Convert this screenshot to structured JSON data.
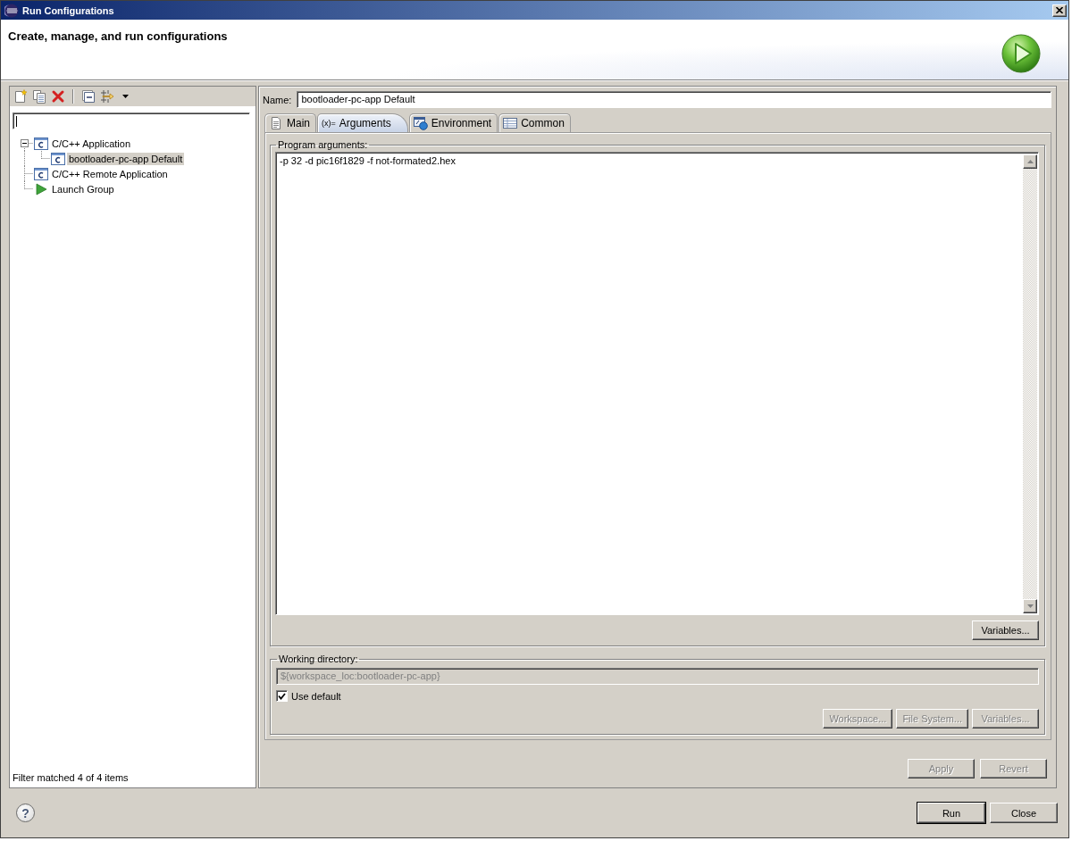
{
  "window": {
    "title": "Run Configurations"
  },
  "header": {
    "title": "Create, manage, and run configurations"
  },
  "filter": {
    "focused": true
  },
  "tree": [
    {
      "label": "C/C++ Application",
      "kind": "c-app",
      "selected": false,
      "expanded": true,
      "children": [
        {
          "label": "bootloader-pc-app Default",
          "kind": "c-app",
          "selected": true
        }
      ]
    },
    {
      "label": "C/C++ Remote Application",
      "kind": "c-app",
      "selected": false
    },
    {
      "label": "Launch Group",
      "kind": "group",
      "selected": false
    }
  ],
  "filter_status": "Filter matched 4 of 4 items",
  "name": {
    "label": "Name:",
    "value": "bootloader-pc-app Default"
  },
  "tabs": [
    {
      "label": "Main",
      "selected": false
    },
    {
      "label": "Arguments",
      "glyph": "(x)=",
      "selected": true
    },
    {
      "label": "Environment",
      "selected": false
    },
    {
      "label": "Common",
      "selected": false
    }
  ],
  "program_arguments": {
    "label": "Program arguments:",
    "value": "-p 32 -d pic16f1829 -f not-formated2.hex",
    "button": {
      "label": "Variables...",
      "disabled": false
    }
  },
  "working_directory": {
    "label": "Working directory:",
    "value": "${workspace_loc:bootloader-pc-app}",
    "disabled": true,
    "use_default": {
      "label": "Use default",
      "checked": true
    },
    "buttons": [
      {
        "label": "Workspace...",
        "disabled": true
      },
      {
        "label": "File System...",
        "disabled": true
      },
      {
        "label": "Variables...",
        "disabled": true
      }
    ]
  },
  "config_buttons": [
    {
      "label": "Apply",
      "disabled": true
    },
    {
      "label": "Revert",
      "disabled": true
    }
  ],
  "help": {
    "glyph": "?"
  },
  "dialog_buttons": [
    {
      "label": "Run",
      "default": true,
      "disabled": false
    },
    {
      "label": "Close",
      "default": false,
      "disabled": false
    }
  ]
}
